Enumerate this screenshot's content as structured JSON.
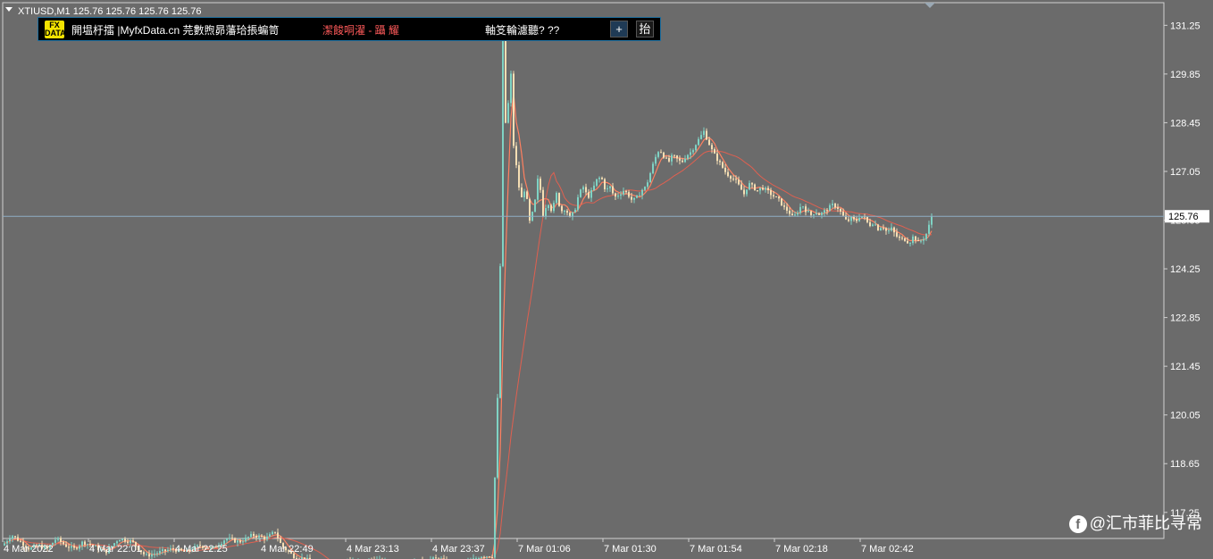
{
  "header": {
    "symbol_text": "XTIUSD,M1  125.76 125.76 125.76 125.76"
  },
  "banner": {
    "logo_text": "FX DATA",
    "site_text": "開塭杅擂 |MyfxData.cn 芫數煦昴藩珨掁蝙笥",
    "alert_text": "潔餕哃濯 - 躡    耀",
    "status_text": "軸笅輪濾聽?   ??",
    "plus_label": "+",
    "hide_label": "抬"
  },
  "watermark": "@汇市菲比寻常",
  "chart_data": {
    "type": "candlestick",
    "title": "",
    "symbol": "XTIUSD",
    "timeframe": "M1",
    "current_price": 125.76,
    "ylim": [
      116.5,
      131.9
    ],
    "y_ticks": [
      "131.25",
      "129.85",
      "128.45",
      "127.05",
      "125.65",
      "124.25",
      "122.85",
      "121.45",
      "120.05",
      "118.65",
      "117.25"
    ],
    "x_ticks": [
      "4 Mar 2022",
      "4 Mar 22:01",
      "4 Mar 22:25",
      "4 Mar 22:49",
      "4 Mar 23:13",
      "4 Mar 23:37",
      "7 Mar 01:06",
      "7 Mar 01:30",
      "7 Mar 01:54",
      "7 Mar 02:18",
      "7 Mar 02:42"
    ],
    "colors": {
      "background": "#6b6b6b",
      "up_candle": "#7fd3c4",
      "down_candle": "#f5deb3",
      "ma_fast": "#ff8060",
      "ma_slow": "#e06050",
      "price_line": "#8faec4"
    },
    "price_path": [
      [
        0,
        116.3
      ],
      [
        10,
        116.6
      ],
      [
        20,
        116.4
      ],
      [
        30,
        116.2
      ],
      [
        40,
        116.3
      ],
      [
        50,
        116.2
      ],
      [
        60,
        116.5
      ],
      [
        70,
        116.3
      ],
      [
        80,
        116.2
      ],
      [
        90,
        116.4
      ],
      [
        100,
        116.3
      ],
      [
        115,
        116.1
      ],
      [
        130,
        116.5
      ],
      [
        145,
        116.4
      ],
      [
        160,
        116.0
      ],
      [
        175,
        116.1
      ],
      [
        190,
        116.2
      ],
      [
        205,
        116.1
      ],
      [
        220,
        116.3
      ],
      [
        235,
        116.2
      ],
      [
        250,
        116.5
      ],
      [
        265,
        116.4
      ],
      [
        280,
        116.6
      ],
      [
        295,
        116.5
      ],
      [
        305,
        116.7
      ],
      [
        312,
        116.3
      ],
      [
        325,
        116.0
      ],
      [
        340,
        115.9
      ],
      [
        355,
        115.6
      ],
      [
        370,
        115.5
      ],
      [
        385,
        115.9
      ],
      [
        400,
        115.8
      ],
      [
        415,
        115.9
      ],
      [
        430,
        115.8
      ],
      [
        445,
        115.7
      ],
      [
        460,
        115.8
      ],
      [
        475,
        115.9
      ],
      [
        490,
        115.9
      ],
      [
        505,
        115.7
      ],
      [
        520,
        115.8
      ],
      [
        535,
        116.0
      ],
      [
        548,
        116.0
      ],
      [
        556,
        122.0
      ],
      [
        560,
        131.3
      ],
      [
        564,
        127.5
      ],
      [
        568,
        130.5
      ],
      [
        572,
        127.8
      ],
      [
        576,
        127.0
      ],
      [
        580,
        126.2
      ],
      [
        585,
        126.6
      ],
      [
        590,
        125.6
      ],
      [
        595,
        126.0
      ],
      [
        600,
        127.0
      ],
      [
        605,
        125.8
      ],
      [
        610,
        126.2
      ],
      [
        615,
        125.9
      ],
      [
        620,
        126.4
      ],
      [
        625,
        125.9
      ],
      [
        630,
        126.0
      ],
      [
        635,
        125.7
      ],
      [
        640,
        125.9
      ],
      [
        645,
        126.4
      ],
      [
        650,
        126.6
      ],
      [
        655,
        126.3
      ],
      [
        660,
        126.5
      ],
      [
        665,
        126.8
      ],
      [
        670,
        126.9
      ],
      [
        675,
        126.5
      ],
      [
        680,
        126.6
      ],
      [
        685,
        126.3
      ],
      [
        690,
        126.4
      ],
      [
        695,
        126.5
      ],
      [
        700,
        126.4
      ],
      [
        705,
        126.2
      ],
      [
        710,
        126.3
      ],
      [
        715,
        126.5
      ],
      [
        720,
        126.6
      ],
      [
        725,
        127.0
      ],
      [
        730,
        127.4
      ],
      [
        735,
        127.7
      ],
      [
        740,
        127.5
      ],
      [
        745,
        127.3
      ],
      [
        750,
        127.5
      ],
      [
        755,
        127.4
      ],
      [
        760,
        127.3
      ],
      [
        765,
        127.5
      ],
      [
        770,
        127.6
      ],
      [
        775,
        127.8
      ],
      [
        780,
        128.0
      ],
      [
        785,
        128.2
      ],
      [
        790,
        127.9
      ],
      [
        795,
        127.6
      ],
      [
        800,
        127.4
      ],
      [
        805,
        127.2
      ],
      [
        810,
        127.0
      ],
      [
        815,
        126.9
      ],
      [
        820,
        126.8
      ],
      [
        825,
        126.6
      ],
      [
        830,
        126.4
      ],
      [
        835,
        126.7
      ],
      [
        840,
        126.6
      ],
      [
        845,
        126.5
      ],
      [
        850,
        126.6
      ],
      [
        855,
        126.5
      ],
      [
        860,
        126.4
      ],
      [
        865,
        126.3
      ],
      [
        870,
        126.2
      ],
      [
        875,
        126.0
      ],
      [
        880,
        125.9
      ],
      [
        885,
        125.7
      ],
      [
        890,
        125.9
      ],
      [
        895,
        126.1
      ],
      [
        900,
        125.9
      ],
      [
        905,
        125.8
      ],
      [
        910,
        125.9
      ],
      [
        915,
        125.8
      ],
      [
        920,
        125.9
      ],
      [
        925,
        126.0
      ],
      [
        930,
        126.1
      ],
      [
        935,
        126.0
      ],
      [
        940,
        125.8
      ],
      [
        945,
        125.6
      ],
      [
        950,
        125.7
      ],
      [
        955,
        125.6
      ],
      [
        960,
        125.8
      ],
      [
        965,
        125.7
      ],
      [
        970,
        125.5
      ],
      [
        975,
        125.6
      ],
      [
        980,
        125.4
      ],
      [
        985,
        125.5
      ],
      [
        990,
        125.3
      ],
      [
        995,
        125.4
      ],
      [
        1000,
        125.2
      ],
      [
        1005,
        125.1
      ],
      [
        1010,
        125.1
      ],
      [
        1015,
        125.0
      ],
      [
        1020,
        125.2
      ],
      [
        1025,
        125.0
      ],
      [
        1030,
        125.1
      ],
      [
        1035,
        125.3
      ],
      [
        1040,
        125.76
      ]
    ]
  }
}
